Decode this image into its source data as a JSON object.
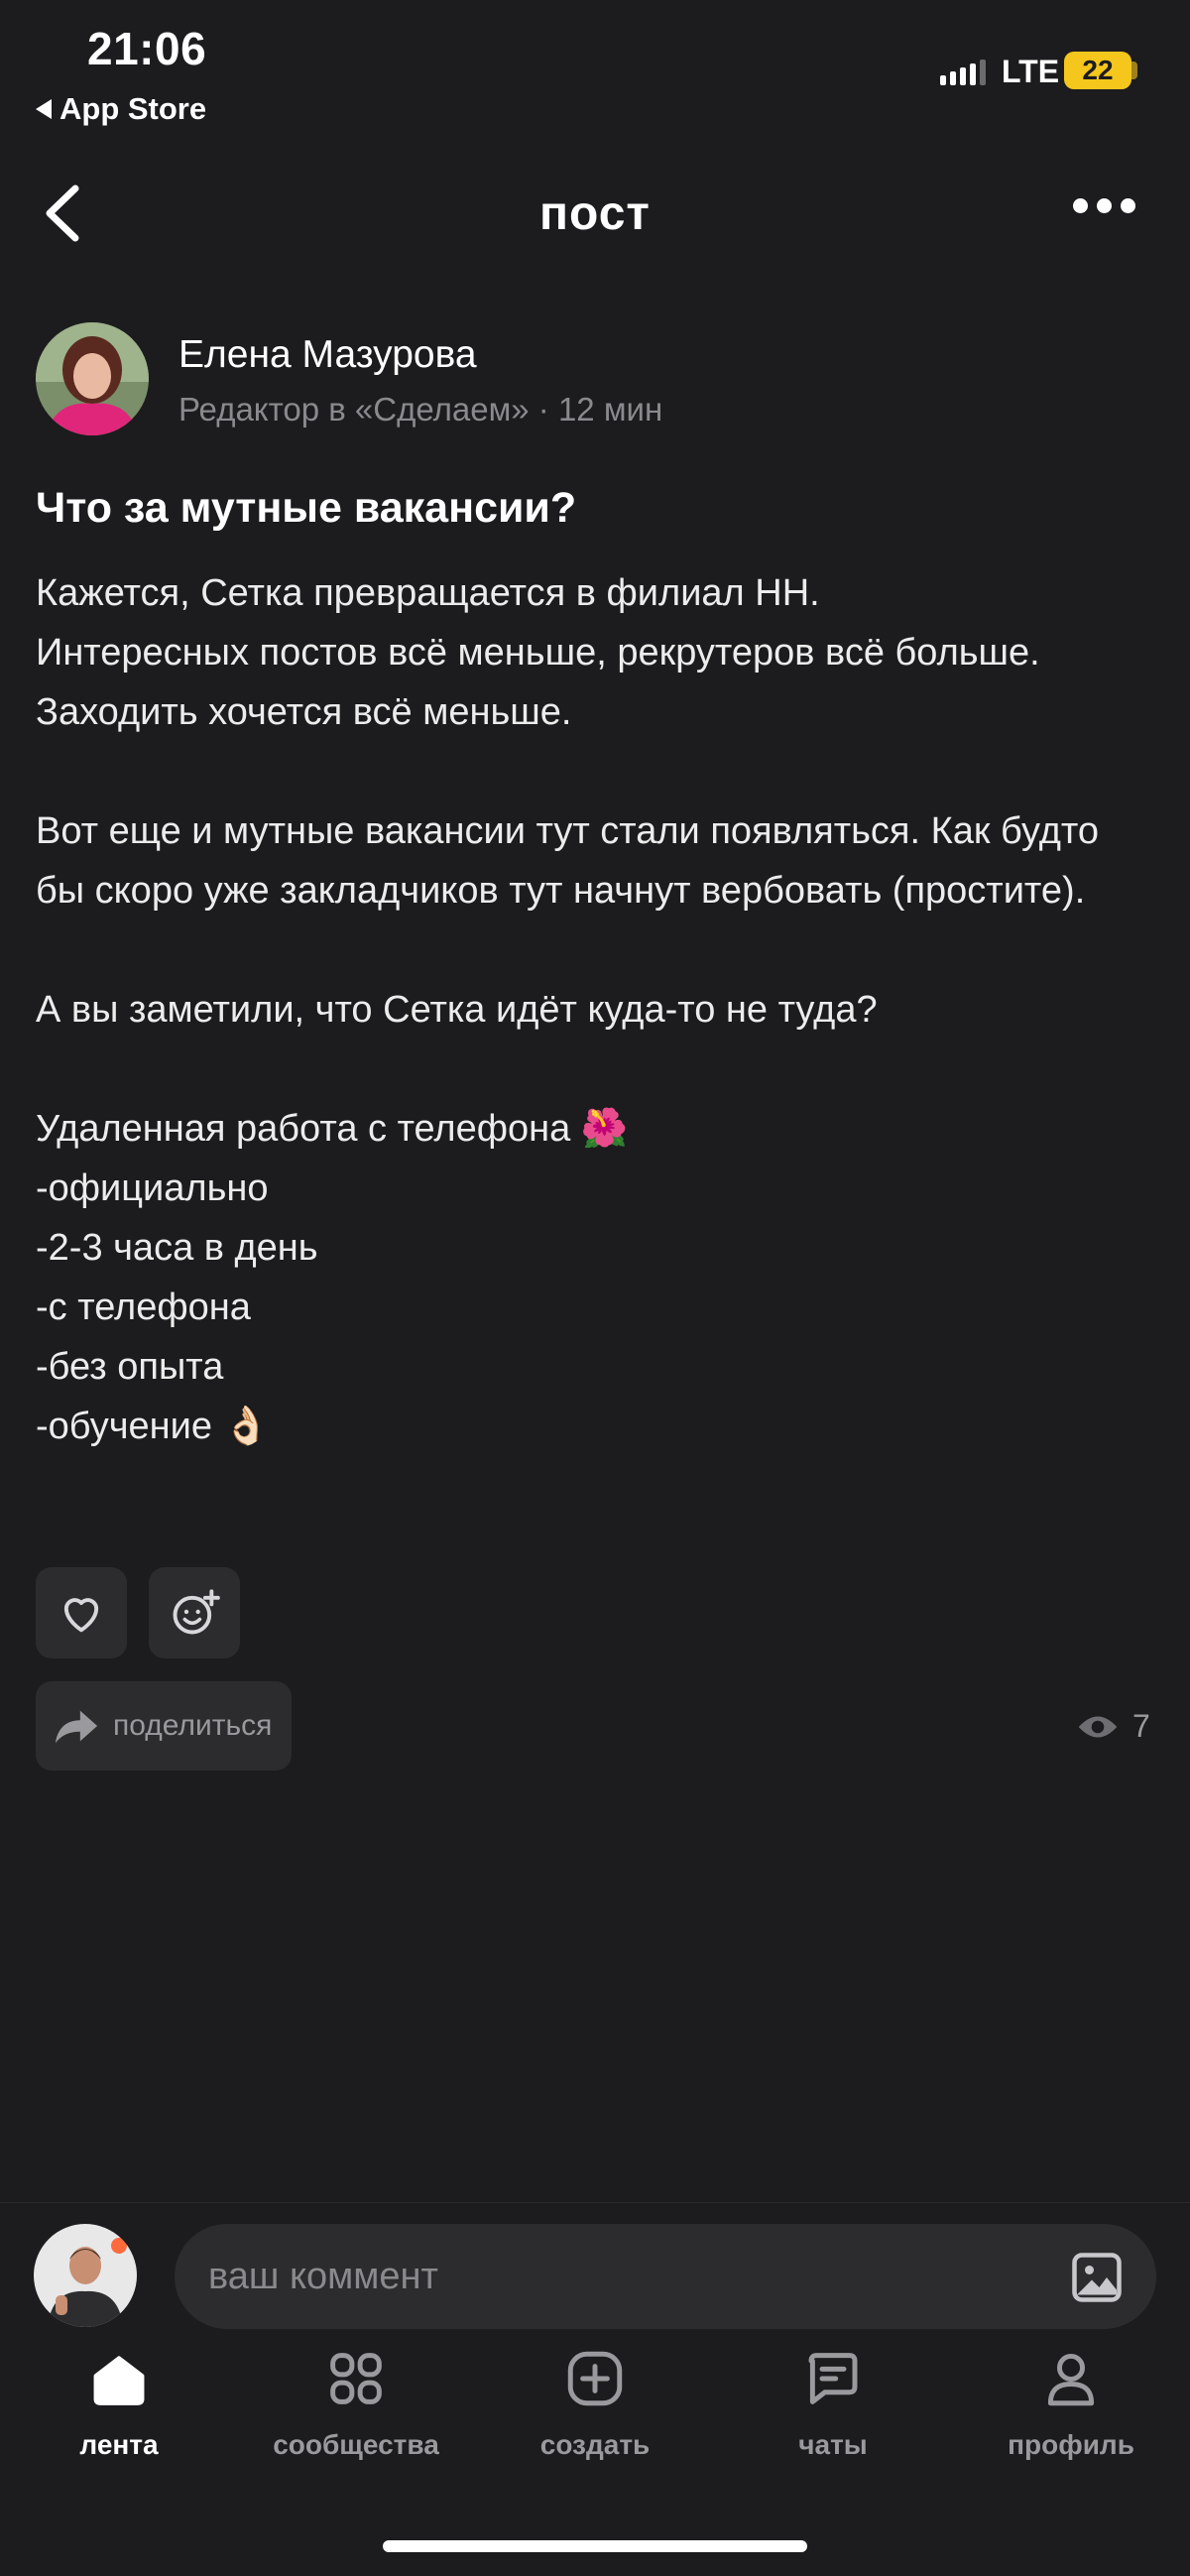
{
  "status_bar": {
    "time": "21:06",
    "back_app": "App Store",
    "network": "LTE",
    "battery": "22"
  },
  "header": {
    "title": "пост"
  },
  "author": {
    "name": "Елена Мазурова",
    "meta": "Редактор в «Сделаем» · 12 мин"
  },
  "post": {
    "title": "Что за мутные вакансии?",
    "body": "Кажется, Сетка превращается в филиал HH.\nИнтересных постов всё меньше, рекрутеров всё больше. Заходить хочется всё меньше.\n\nВот еще и мутные вакансии тут стали появляться. Как будто бы скоро уже закладчиков тут начнут вербовать (простите).\n\nА вы заметили, что Сетка идёт куда-то не туда?\n\nУдаленная работа с телефона 🌺\n-официально\n-2-3 часа в день\n-с телефона\n-без опыта\n-обучение 👌🏻"
  },
  "actions": {
    "share_label": "поделиться",
    "views": "7"
  },
  "comment": {
    "placeholder": "ваш коммент"
  },
  "tabbar": {
    "items": [
      {
        "label": "лента",
        "icon": "home-icon",
        "active": true
      },
      {
        "label": "сообщества",
        "icon": "grid-icon",
        "active": false
      },
      {
        "label": "создать",
        "icon": "plus-square-icon",
        "active": false
      },
      {
        "label": "чаты",
        "icon": "chat-icon",
        "active": false
      },
      {
        "label": "профиль",
        "icon": "person-icon",
        "active": false
      }
    ]
  },
  "colors": {
    "background": "#1c1c1e",
    "surface": "#2c2c2e",
    "muted_text": "#8a8a8e",
    "battery": "#f5c61b"
  }
}
